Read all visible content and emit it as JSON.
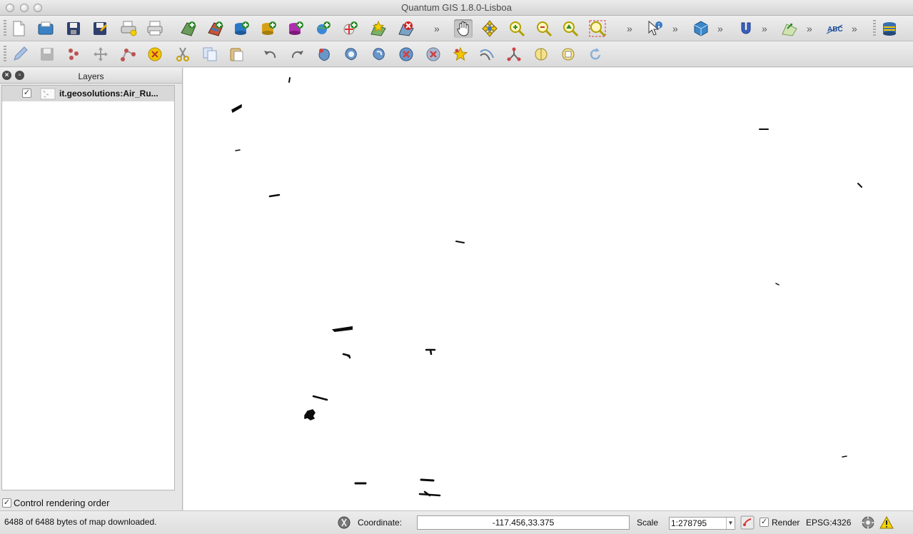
{
  "window": {
    "title": "Quantum GIS 1.8.0-Lisboa"
  },
  "toolbar1": {
    "overflow": "»",
    "buttons": [
      "new-project",
      "open-project",
      "save-project",
      "save-project-as",
      "new-print-composer",
      "print",
      "add-vector-layer",
      "add-raster-layer",
      "add-postgis-layer",
      "add-spatialite-layer",
      "add-wms-layer",
      "add-wfs-layer",
      "new-shapefile-layer",
      "remove-layer",
      "pan-map",
      "pan-to-selection",
      "zoom-in",
      "zoom-out",
      "zoom-full",
      "zoom-to-selection",
      "identify-features",
      "3d-view",
      "plugin-magnet",
      "georeferencer",
      "spell-label",
      "database"
    ]
  },
  "toolbar2": {
    "buttons": [
      "toggle-editing",
      "save-edits",
      "add-feature",
      "move-feature",
      "node-tool",
      "delete-selected",
      "cut-features",
      "copy-features",
      "paste-features",
      "undo",
      "redo",
      "simplify-feature",
      "add-ring",
      "add-part",
      "delete-ring",
      "delete-part",
      "reshape-features",
      "offset-curve",
      "split-features",
      "merge-features",
      "merge-attributes",
      "rotate-point-symbols"
    ]
  },
  "layers_panel": {
    "title": "Layers",
    "layers": [
      {
        "name": "it.geosolutions:Air_Ru...",
        "checked": true
      }
    ],
    "control_rendering_order": {
      "label": "Control rendering order",
      "checked": true
    }
  },
  "map": {
    "feature_color": "#0c0c0c",
    "background": "#ffffff"
  },
  "statusbar": {
    "download_status": "6488 of 6488 bytes of map downloaded.",
    "coordinate_label": "Coordinate:",
    "coordinate_value": "-117.456,33.375",
    "scale_label": "Scale",
    "scale_value": "1:278795",
    "render_label": "Render",
    "render_checked": true,
    "crs": "EPSG:4326"
  }
}
